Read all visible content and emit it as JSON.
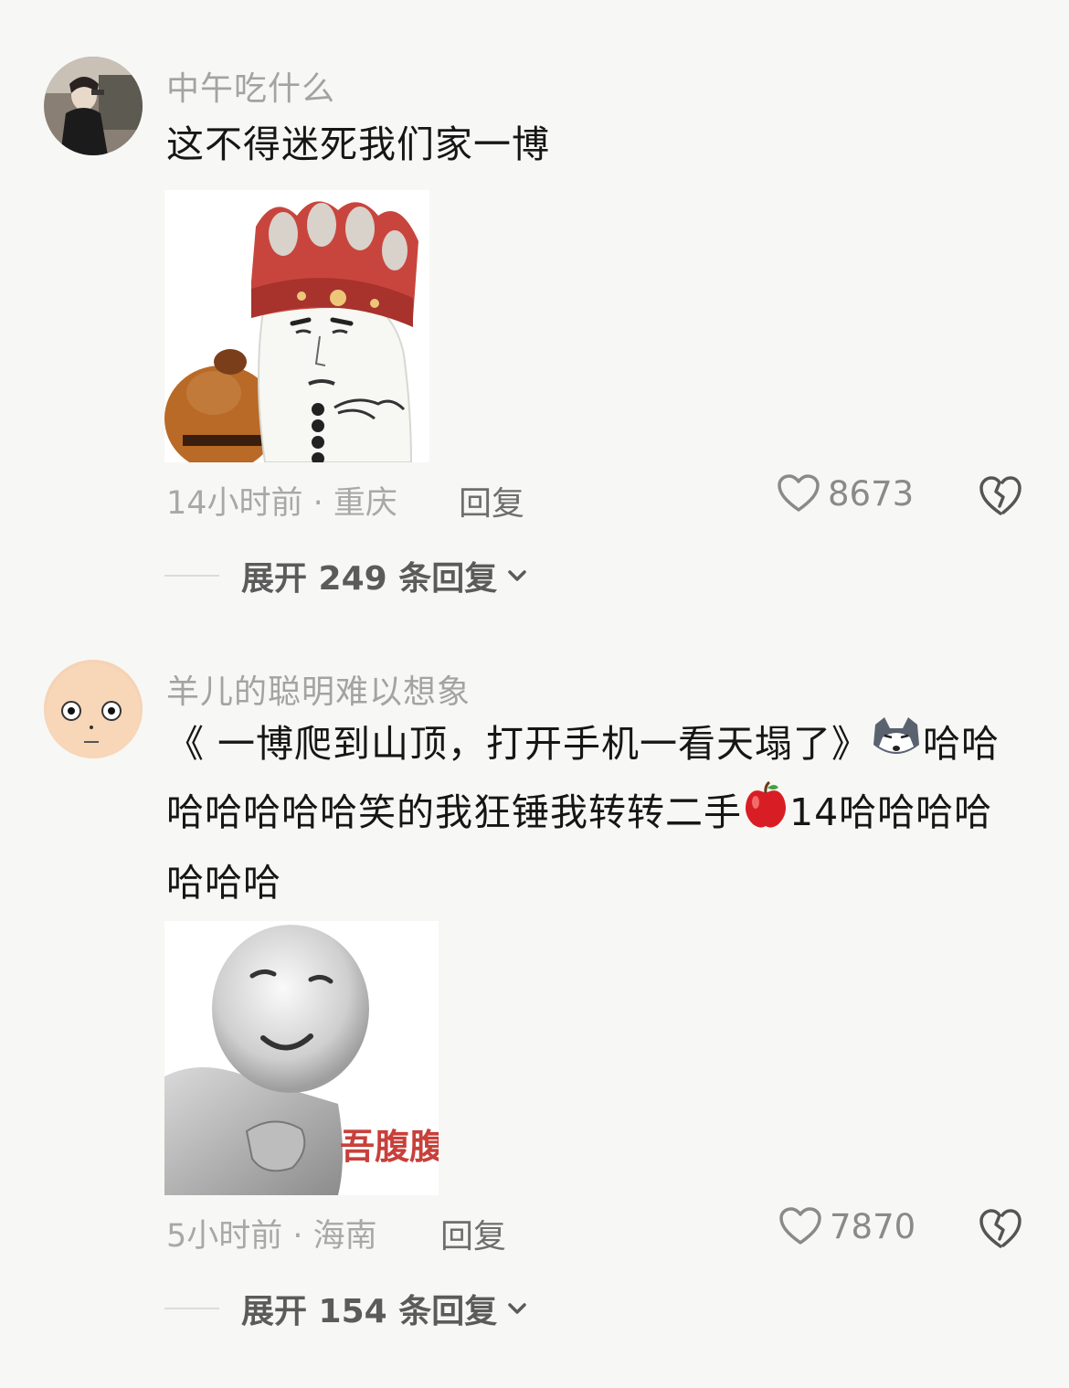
{
  "comments": [
    {
      "username": "中午吃什么",
      "text": "这不得迷死我们家一博",
      "time_location": "14小时前 · 重庆",
      "reply_label": "回复",
      "likes": "8673",
      "expand_label": "展开 249 条回复",
      "avatar_icon": "user-photo-avatar",
      "sticker_icon": "tang-monk-meme-sticker"
    },
    {
      "username": "羊儿的聪明难以想象",
      "text_part1": "《 一博爬到山顶，打开手机一看天塌了》",
      "text_part2": "哈哈哈哈哈哈哈笑的我狂锤我转转二手",
      "text_part3": "14哈哈哈哈哈哈哈",
      "time_location": "5小时前 · 海南",
      "reply_label": "回复",
      "likes": "7870",
      "expand_label": "展开 154 条回复",
      "avatar_icon": "bald-cartoon-avatar",
      "sticker_icon": "laughing-white-figure-sticker",
      "sticker_caption": "吾腹腹",
      "emoji_1": "wolf-emoji",
      "emoji_2": "red-apple-emoji"
    }
  ],
  "colors": {
    "background": "#f7f7f5",
    "username": "#a3a3a3",
    "text": "#161616",
    "meta": "#a8a8a8"
  }
}
